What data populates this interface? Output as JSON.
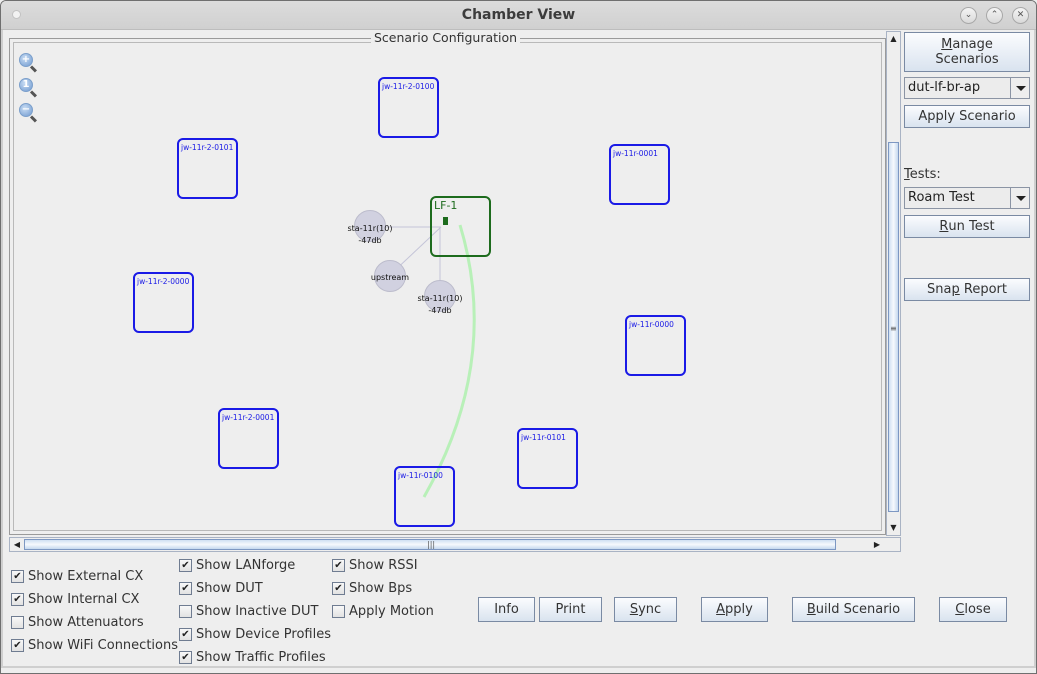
{
  "window": {
    "title": "Chamber View",
    "controls": {
      "minimize": "⌄",
      "maximize": "⌃",
      "close": "✕"
    }
  },
  "scenario_panel": {
    "title": "Scenario Configuration",
    "zoom_icons": [
      "zoom-in-icon",
      "zoom-reset-icon",
      "zoom-out-icon"
    ],
    "duts": [
      {
        "label": "jw-11r-2-0100"
      },
      {
        "label": "jw-11r-2-0101"
      },
      {
        "label": "jw-11r-0001"
      },
      {
        "label": "jw-11r-2-0000"
      },
      {
        "label": "jw-11r-0000"
      },
      {
        "label": "jw-11r-2-0001"
      },
      {
        "label": "jw-11r-0101"
      },
      {
        "label": "jw-11r-0100"
      }
    ],
    "lanforge": {
      "label": "LF-1"
    },
    "nodes": [
      {
        "label": "sta-11r(10)",
        "rssi": "-47db"
      },
      {
        "label": "upstream",
        "rssi": ""
      },
      {
        "label": "sta-11r(10)",
        "rssi": "-47db"
      }
    ],
    "colors": {
      "dut": "#1a1ae6",
      "lanforge": "#1d6b1d",
      "wifi_link": "#b8f0b8",
      "node": "#d1d1e0"
    }
  },
  "right_panel": {
    "manage_scenarios_line1": "Manage",
    "manage_scenarios_line1_mnemonic": "M",
    "manage_scenarios_line1_rest": "anage",
    "manage_scenarios_line2": "Scenarios",
    "scenario_select": "dut-lf-br-ap",
    "apply_scenario": "Apply Scenario",
    "tests_label_mnemonic": "T",
    "tests_label_rest": "ests:",
    "test_select": "Roam Test",
    "run_test_mnemonic": "R",
    "run_test_rest": "un Test",
    "snap_report_pre": "Sna",
    "snap_report_mnemonic": "p",
    "snap_report_post": " Report"
  },
  "checkboxes": {
    "col1": [
      {
        "label": "Show External CX",
        "checked": true
      },
      {
        "label": "Show Internal CX",
        "checked": true
      },
      {
        "label": "Show Attenuators",
        "checked": false
      },
      {
        "label": "Show WiFi Connections",
        "checked": true
      }
    ],
    "col2": [
      {
        "label": "Show LANforge",
        "checked": true
      },
      {
        "label": "Show DUT",
        "checked": true
      },
      {
        "label": "Show Inactive DUT",
        "checked": false
      },
      {
        "label": "Show Device Profiles",
        "checked": true
      },
      {
        "label": "Show Traffic Profiles",
        "checked": true
      }
    ],
    "col3": [
      {
        "label": "Show RSSI",
        "checked": true
      },
      {
        "label": "Show Bps",
        "checked": true
      },
      {
        "label": "Apply Motion",
        "checked": false
      }
    ]
  },
  "bottom_buttons": {
    "info": "Info",
    "print": "Print",
    "sync_mnemonic": "S",
    "sync_rest": "ync",
    "apply_mnemonic": "A",
    "apply_rest": "pply",
    "build_mnemonic": "B",
    "build_rest": "uild Scenario",
    "close_mnemonic": "C",
    "close_rest": "lose"
  }
}
